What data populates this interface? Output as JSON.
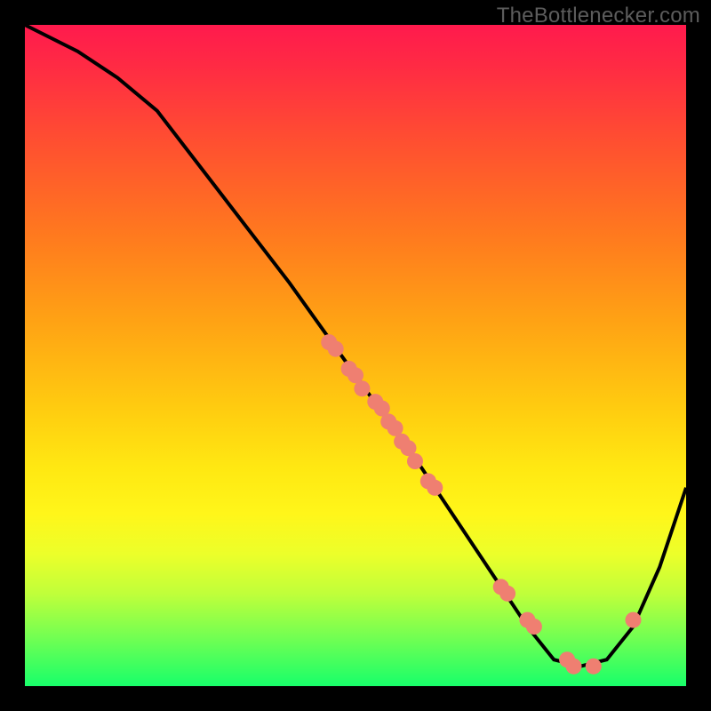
{
  "watermark": "TheBottlenecker.com",
  "chart_data": {
    "type": "line",
    "title": "",
    "xlabel": "",
    "ylabel": "",
    "xlim": [
      0,
      100
    ],
    "ylim": [
      0,
      100
    ],
    "curve": {
      "x": [
        0,
        8,
        14,
        20,
        30,
        40,
        50,
        60,
        70,
        76,
        80,
        84,
        88,
        92,
        96,
        100
      ],
      "y": [
        100,
        96,
        92,
        87,
        74,
        61,
        47,
        33,
        18,
        9,
        4,
        3,
        4,
        9,
        18,
        30
      ]
    },
    "scatter": {
      "x": [
        46,
        47,
        49,
        50,
        51,
        53,
        54,
        55,
        56,
        57,
        58,
        59,
        61,
        62,
        72,
        73,
        76,
        77,
        82,
        83,
        86,
        92
      ],
      "y": [
        52,
        51,
        48,
        47,
        45,
        43,
        42,
        40,
        39,
        37,
        36,
        34,
        31,
        30,
        15,
        14,
        10,
        9,
        4,
        3,
        3,
        10
      ]
    },
    "gradient_note": "vertical background gradient encodes value: red≈high (100), green≈low (0)"
  }
}
